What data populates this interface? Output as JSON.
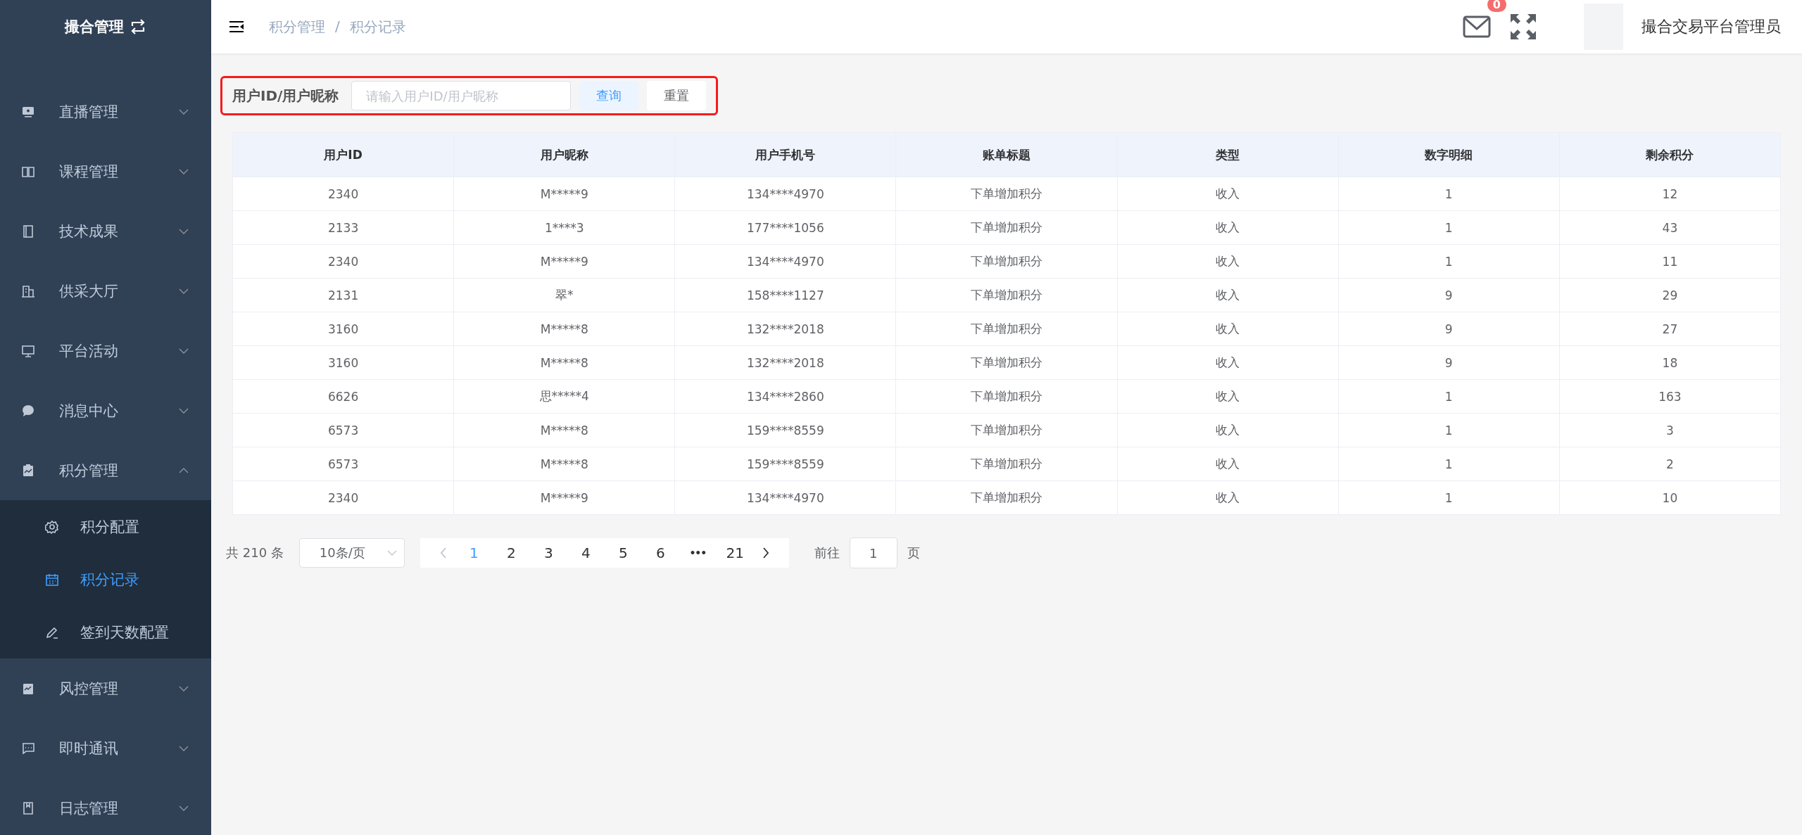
{
  "sidebar": {
    "title": "撮合管理",
    "items": [
      {
        "label": "直播管理",
        "kind": "monitor",
        "expanded": false
      },
      {
        "label": "课程管理",
        "kind": "book",
        "expanded": false
      },
      {
        "label": "技术成果",
        "kind": "doc",
        "expanded": false
      },
      {
        "label": "供采大厅",
        "kind": "building",
        "expanded": false
      },
      {
        "label": "平台活动",
        "kind": "screen",
        "expanded": false
      },
      {
        "label": "消息中心",
        "kind": "bubble",
        "expanded": false
      },
      {
        "label": "积分管理",
        "kind": "clipboard",
        "expanded": true,
        "children": [
          {
            "label": "积分配置",
            "kind": "gear",
            "selected": false
          },
          {
            "label": "积分记录",
            "kind": "calendar",
            "selected": true
          },
          {
            "label": "签到天数配置",
            "kind": "pen",
            "selected": false
          }
        ]
      },
      {
        "label": "风控管理",
        "kind": "chart",
        "expanded": false
      },
      {
        "label": "即时通讯",
        "kind": "chat",
        "expanded": false
      },
      {
        "label": "日志管理",
        "kind": "log",
        "expanded": false
      }
    ]
  },
  "header": {
    "breadcrumb": [
      "积分管理",
      "积分记录"
    ],
    "breadcrumb_separator": "/",
    "message_count": "0",
    "user_name": "撮合交易平台管理员"
  },
  "search": {
    "label": "用户ID/用户昵称",
    "placeholder": "请输入用户ID/用户昵称",
    "buttons": [
      "查询",
      "重置"
    ]
  },
  "table": {
    "columns": [
      "用户ID",
      "用户昵称",
      "用户手机号",
      "账单标题",
      "类型",
      "数字明细",
      "剩余积分"
    ],
    "rows": [
      [
        "2340",
        "M*****9",
        "134****4970",
        "下单增加积分",
        "收入",
        "1",
        "12"
      ],
      [
        "2133",
        "1****3",
        "177****1056",
        "下单增加积分",
        "收入",
        "1",
        "43"
      ],
      [
        "2340",
        "M*****9",
        "134****4970",
        "下单增加积分",
        "收入",
        "1",
        "11"
      ],
      [
        "2131",
        "翠*",
        "158****1127",
        "下单增加积分",
        "收入",
        "9",
        "29"
      ],
      [
        "3160",
        "M*****8",
        "132****2018",
        "下单增加积分",
        "收入",
        "9",
        "27"
      ],
      [
        "3160",
        "M*****8",
        "132****2018",
        "下单增加积分",
        "收入",
        "9",
        "18"
      ],
      [
        "6626",
        "思*****4",
        "134****2860",
        "下单增加积分",
        "收入",
        "1",
        "163"
      ],
      [
        "6573",
        "M*****8",
        "159****8559",
        "下单增加积分",
        "收入",
        "1",
        "3"
      ],
      [
        "6573",
        "M*****8",
        "159****8559",
        "下单增加积分",
        "收入",
        "1",
        "2"
      ],
      [
        "2340",
        "M*****9",
        "134****4970",
        "下单增加积分",
        "收入",
        "1",
        "10"
      ]
    ]
  },
  "pagination": {
    "total": "共 210 条",
    "page_size": "10条/页",
    "prev_disabled": true,
    "next_disabled": false,
    "pages": [
      {
        "kind": "page",
        "label": "1",
        "selected": true
      },
      {
        "kind": "page",
        "label": "2",
        "selected": false
      },
      {
        "kind": "page",
        "label": "3",
        "selected": false
      },
      {
        "kind": "page",
        "label": "4",
        "selected": false
      },
      {
        "kind": "page",
        "label": "5",
        "selected": false
      },
      {
        "kind": "page",
        "label": "6",
        "selected": false
      },
      {
        "kind": "more",
        "label": "•••",
        "selected": false
      },
      {
        "kind": "page",
        "label": "21",
        "selected": false
      }
    ],
    "goto_label": "前往",
    "goto_value": "1",
    "goto_suffix": "页"
  }
}
